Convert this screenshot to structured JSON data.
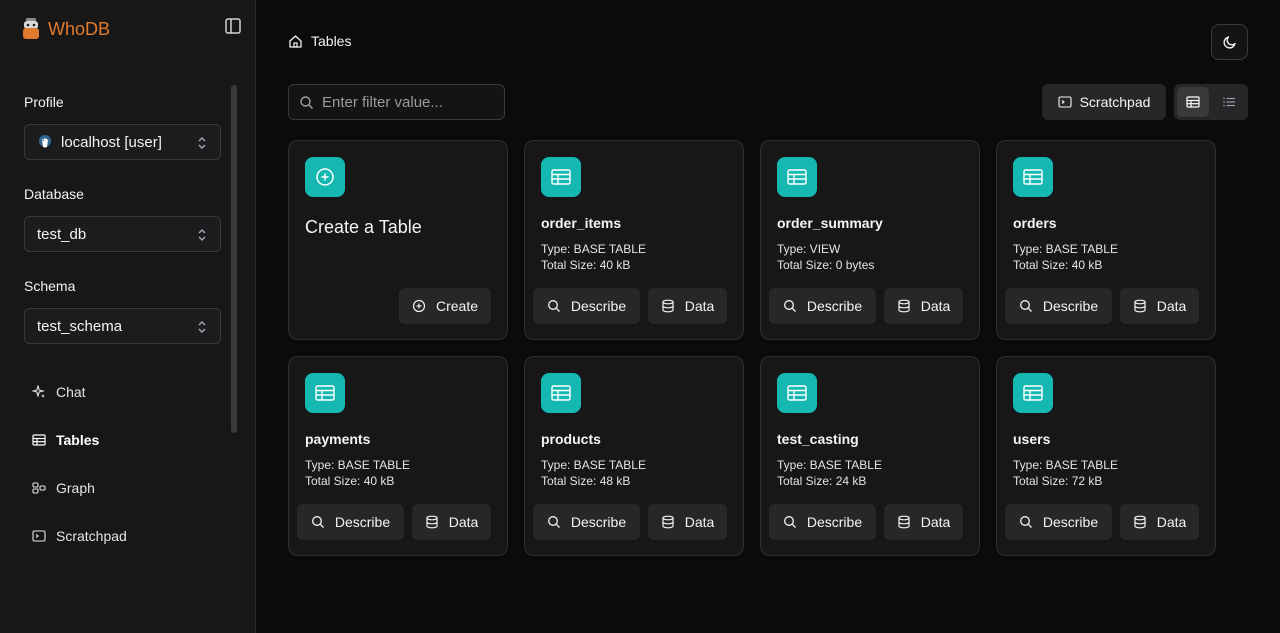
{
  "app": {
    "name": "WhoDB"
  },
  "sidebar": {
    "profile_label": "Profile",
    "profile_value": "localhost [user]",
    "database_label": "Database",
    "database_value": "test_db",
    "schema_label": "Schema",
    "schema_value": "test_schema",
    "nav": [
      {
        "label": "Chat",
        "icon": "sparkles-icon"
      },
      {
        "label": "Tables",
        "icon": "table-icon",
        "active": true
      },
      {
        "label": "Graph",
        "icon": "graph-icon"
      },
      {
        "label": "Scratchpad",
        "icon": "terminal-icon"
      }
    ]
  },
  "header": {
    "breadcrumb": "Tables"
  },
  "toolbar": {
    "filter_placeholder": "Enter filter value...",
    "scratchpad_label": "Scratchpad"
  },
  "create_card": {
    "title": "Create a Table",
    "button": "Create"
  },
  "card_buttons": {
    "describe": "Describe",
    "data": "Data"
  },
  "tables": [
    {
      "name": "order_items",
      "type": "Type: BASE TABLE",
      "size": "Total Size: 40 kB"
    },
    {
      "name": "order_summary",
      "type": "Type: VIEW",
      "size": "Total Size: 0 bytes"
    },
    {
      "name": "orders",
      "type": "Type: BASE TABLE",
      "size": "Total Size: 40 kB"
    },
    {
      "name": "payments",
      "type": "Type: BASE TABLE",
      "size": "Total Size: 40 kB"
    },
    {
      "name": "products",
      "type": "Type: BASE TABLE",
      "size": "Total Size: 48 kB"
    },
    {
      "name": "test_casting",
      "type": "Type: BASE TABLE",
      "size": "Total Size: 24 kB"
    },
    {
      "name": "users",
      "type": "Type: BASE TABLE",
      "size": "Total Size: 72 kB"
    }
  ],
  "colors": {
    "accent": "#14b8b0",
    "brand": "#e07a2f"
  }
}
